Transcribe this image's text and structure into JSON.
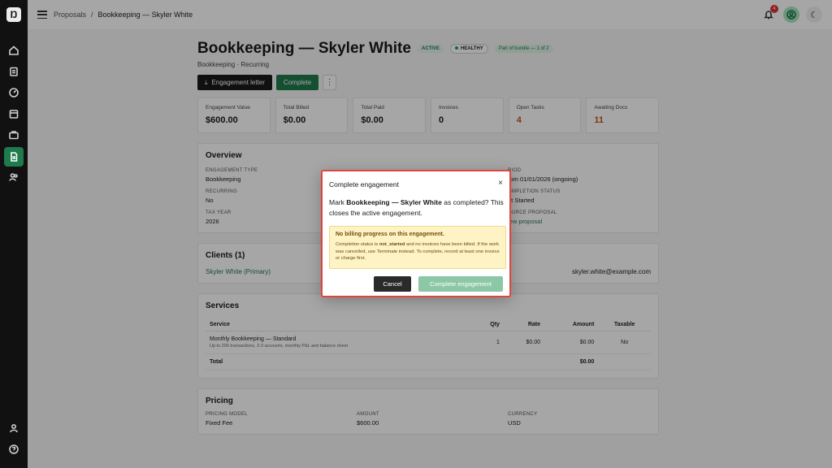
{
  "breadcrumb": {
    "parent": "Proposals",
    "separator": "/",
    "current": "Bookkeeping — Skyler White"
  },
  "topbar": {
    "notification_count": "4"
  },
  "header": {
    "title": "Bookkeeping — Skyler White",
    "badges": {
      "status": "ACTIVE",
      "health": "HEALTHY",
      "bundle": "Part of bundle — 1 of 2"
    },
    "subtitle": "Bookkeeping · Recurring",
    "actions": {
      "engagement_letter": "Engagement letter",
      "complete": "Complete",
      "more": "⋮"
    }
  },
  "stats": [
    {
      "label": "Engagement Value",
      "value": "$600.00"
    },
    {
      "label": "Total Billed",
      "value": "$0.00"
    },
    {
      "label": "Total Paid",
      "value": "$0.00"
    },
    {
      "label": "Invoices",
      "value": "0"
    },
    {
      "label": "Open Tasks",
      "value": "4"
    },
    {
      "label": "Awaiting Docs",
      "value": "11"
    }
  ],
  "overview": {
    "title": "Overview",
    "fields": {
      "engagement_type": {
        "label": "ENGAGEMENT TYPE",
        "value": "Bookkeeping"
      },
      "period": {
        "label": "RIOD",
        "value": "rom 01/01/2026 (ongoing)"
      },
      "recurring": {
        "label": "RECURRING",
        "value": "No"
      },
      "completion_status": {
        "label": "OMPLETION STATUS",
        "value": "ot Started"
      },
      "tax_year": {
        "label": "TAX YEAR",
        "value": "2026"
      },
      "source_proposal": {
        "label": "OURCE PROPOSAL",
        "value": "iew proposal"
      }
    }
  },
  "clients": {
    "title": "Clients (1)",
    "name": "Skyler White (Primary)",
    "email": "skyler.white@example.com"
  },
  "services": {
    "title": "Services",
    "headers": {
      "service": "Service",
      "qty": "Qty",
      "rate": "Rate",
      "amount": "Amount",
      "taxable": "Taxable"
    },
    "rows": [
      {
        "service": "Monthly Bookkeeping — Standard",
        "description": "Up to 200 transactions, 2-3 accounts, monthly P&L and balance sheet",
        "qty": "1",
        "rate": "$0.00",
        "amount": "$0.00",
        "taxable": "No"
      }
    ],
    "total_label": "Total",
    "total_value": "$0.00"
  },
  "pricing": {
    "title": "Pricing",
    "fields": {
      "model": {
        "label": "PRICING MODEL",
        "value": "Fixed Fee"
      },
      "amount": {
        "label": "AMOUNT",
        "value": "$600.00"
      },
      "currency": {
        "label": "CURRENCY",
        "value": "USD"
      }
    }
  },
  "modal": {
    "title": "Complete engagement",
    "close": "×",
    "body_prefix": "Mark ",
    "body_bold": "Bookkeeping — Skyler White",
    "body_suffix": " as completed? This closes the active engagement.",
    "warning": {
      "title": "No billing progress on this engagement.",
      "text1": "Completion status is ",
      "status": "not_started",
      "text2": " and no invoices have been billed. If the work was cancelled, use ",
      "terminate": "Terminate",
      "text3": " instead. To complete, record at least one invoice or charge first."
    },
    "cancel": "Cancel",
    "confirm": "Complete engagement"
  },
  "colors": {
    "accent": "#1f7a4c",
    "modal_border": "#e0453e",
    "warning_bg": "#fdf3c4"
  }
}
